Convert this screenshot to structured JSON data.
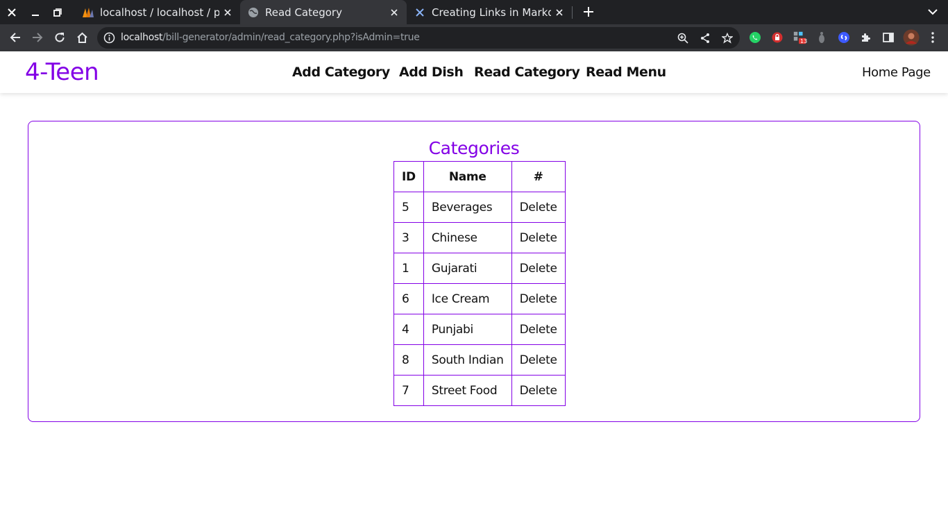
{
  "browser": {
    "tabs": [
      {
        "title": "localhost / localhost / proje",
        "favicon": "phpmyadmin-icon",
        "active": false
      },
      {
        "title": "Read Category",
        "favicon": "globe-icon",
        "active": true
      },
      {
        "title": "Creating Links in Markdown",
        "favicon": "markdown-site-icon",
        "active": false
      }
    ],
    "url_host": "localhost",
    "url_path": "/bill-generator/admin/read_category.php?isAdmin=true",
    "extension_badge": "13",
    "icons": [
      "zoom-icon",
      "share-icon",
      "star-icon",
      "whatsapp-icon",
      "lock-extension-icon",
      "extension-badge-icon",
      "extension-grey-icon",
      "shazam-icon",
      "puzzle-icon",
      "sidepanel-icon",
      "profile-avatar"
    ]
  },
  "site": {
    "logo": "4-Teen",
    "nav": {
      "add_category": "Add Category",
      "add_dish": "Add Dish",
      "read_category": "Read Category",
      "read_menu": "Read Menu",
      "home": "Home Page"
    },
    "accent_color": "#8300e6"
  },
  "categories": {
    "title": "Categories",
    "headers": {
      "id": "ID",
      "name": "Name",
      "action": "#"
    },
    "rows": [
      {
        "id": "5",
        "name": "Beverages",
        "action": "Delete"
      },
      {
        "id": "3",
        "name": "Chinese",
        "action": "Delete"
      },
      {
        "id": "1",
        "name": "Gujarati",
        "action": "Delete"
      },
      {
        "id": "6",
        "name": "Ice Cream",
        "action": "Delete"
      },
      {
        "id": "4",
        "name": "Punjabi",
        "action": "Delete"
      },
      {
        "id": "8",
        "name": "South Indian",
        "action": "Delete"
      },
      {
        "id": "7",
        "name": "Street Food",
        "action": "Delete"
      }
    ]
  }
}
